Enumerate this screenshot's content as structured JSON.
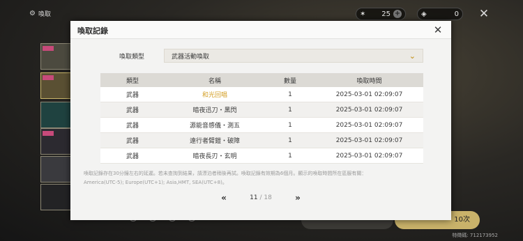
{
  "background": {
    "title": "喚取",
    "currency_1_value": "25",
    "currency_2_value": "0",
    "ten_pull_label": "10次",
    "uid_label": "特徵碼: 712173952"
  },
  "modal": {
    "title": "喚取記錄",
    "filter": {
      "label": "喚取類型",
      "value": "武器活動喚取"
    },
    "table": {
      "headers": [
        "類型",
        "名稱",
        "數量",
        "喚取時間"
      ],
      "rows": [
        {
          "type": "武器",
          "name": "和光回唱",
          "count": "1",
          "time": "2025-03-01 02:09:07",
          "highlight": true
        },
        {
          "type": "武器",
          "name": "暗夜迅刀・黑閃",
          "count": "1",
          "time": "2025-03-01 02:09:07",
          "highlight": false
        },
        {
          "type": "武器",
          "name": "源能音感儀・測五",
          "count": "1",
          "time": "2025-03-01 02:09:07",
          "highlight": false
        },
        {
          "type": "武器",
          "name": "遠行者臂鎧・破障",
          "count": "1",
          "time": "2025-03-01 02:09:07",
          "highlight": false
        },
        {
          "type": "武器",
          "name": "暗夜長刃・玄明",
          "count": "1",
          "time": "2025-03-01 02:09:07",
          "highlight": false
        }
      ]
    },
    "note_line1": "喚取記錄存在30分鐘左右的延遲。若未查詢到結果，請漂泊者稍後再試。喚取記錄有效期為6個月。顯示的喚取時間所在區服有關：",
    "note_line2": "America(UTC-5); Europe(UTC+1); Asia,HMT, SEA(UTC+8)。",
    "pager": {
      "current": "11",
      "separator": "/",
      "total": "18"
    }
  }
}
